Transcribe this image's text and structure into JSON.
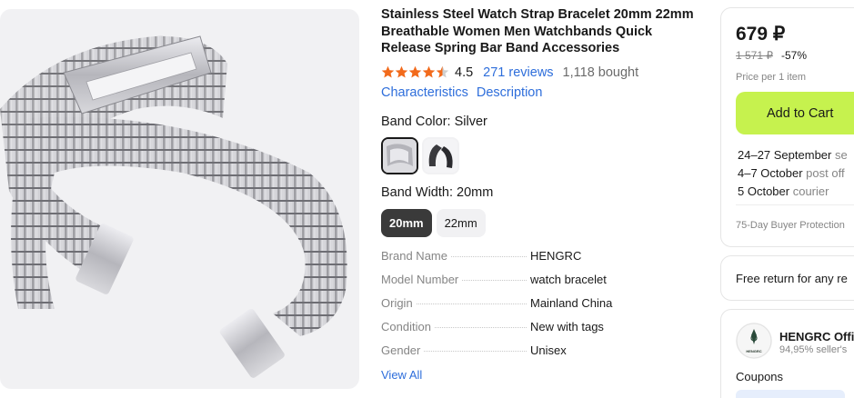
{
  "product": {
    "title": "Stainless Steel Watch Strap Bracelet 20mm 22mm Breathable Women Men Watchbands Quick Release Spring Bar Band Accessories",
    "rating": "4.5",
    "reviews": "271 reviews",
    "bought": "1,118 bought",
    "rating_stars": 4.5,
    "star_color": "#f26a1b"
  },
  "nav": {
    "characteristics": "Characteristics",
    "description": "Description"
  },
  "options": {
    "color_label": "Band Color: Silver",
    "width_label": "Band Width: 20mm",
    "widths": [
      "20mm",
      "22mm"
    ]
  },
  "specs": [
    {
      "key": "Brand Name",
      "value": "HENGRC"
    },
    {
      "key": "Model Number",
      "value": "watch bracelet"
    },
    {
      "key": "Origin",
      "value": "Mainland China"
    },
    {
      "key": "Condition",
      "value": "New with tags"
    },
    {
      "key": "Gender",
      "value": "Unisex"
    }
  ],
  "view_all": "View All",
  "buy": {
    "price": "679 ₽",
    "old_price": "1 571 ₽",
    "discount": "-57%",
    "price_note": "Price per 1 item",
    "cart_label": "Add to Cart",
    "cart_color": "#c6f24e",
    "delivery": [
      {
        "date": "24–27 September",
        "method": "se"
      },
      {
        "date": "4–7 October",
        "method": "post off"
      },
      {
        "date": "5 October",
        "method": "courier"
      }
    ],
    "protection": "75-Day Buyer Protection"
  },
  "returns": {
    "label": "Free return for any re"
  },
  "store": {
    "name": "HENGRC Offi",
    "rating": "94,95% seller's",
    "logo_text": "HENGRC",
    "coupons": "Coupons"
  }
}
